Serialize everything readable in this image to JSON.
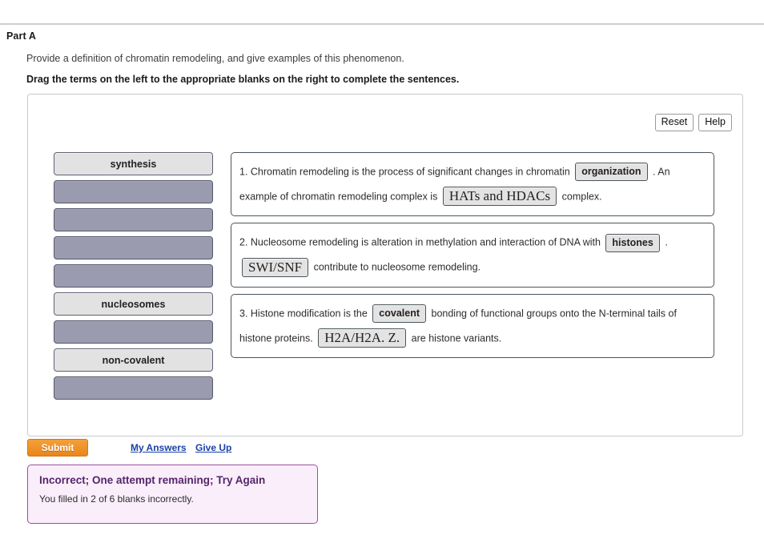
{
  "part": {
    "title": "Part A",
    "prompt": "Provide a definition of chromatin remodeling, and give examples of this phenomenon.",
    "instruction": "Drag the terms on the left to the appropriate blanks on the right to complete the sentences."
  },
  "toolbar": {
    "reset_label": "Reset",
    "help_label": "Help"
  },
  "term_bank": {
    "terms": [
      {
        "label": "synthesis",
        "state": "available"
      },
      {
        "label": "",
        "state": "used"
      },
      {
        "label": "",
        "state": "used"
      },
      {
        "label": "",
        "state": "used"
      },
      {
        "label": "",
        "state": "used"
      },
      {
        "label": "nucleosomes",
        "state": "available"
      },
      {
        "label": "",
        "state": "used"
      },
      {
        "label": "non-covalent",
        "state": "available"
      },
      {
        "label": "",
        "state": "used"
      }
    ]
  },
  "sentences": [
    {
      "part1": "1. Chromatin remodeling is the process of significant changes in chromatin",
      "blank1": "organization",
      "part2": ". An example of chromatin remodeling complex is",
      "blank2": "HATs and HDACs",
      "part3": "complex."
    },
    {
      "part1": "2. Nucleosome remodeling is alteration in methylation and interaction of DNA with",
      "blank1": "histones",
      "part2": ".",
      "blank2": "SWI/SNF",
      "part3": "contribute to nucleosome remodeling."
    },
    {
      "part1": "3. Histone modification is the",
      "blank1": "covalent",
      "part2": "bonding of functional groups onto the N-terminal tails of histone proteins.",
      "blank2": "H2A/H2A. Z.",
      "part3": "are histone variants."
    }
  ],
  "actions": {
    "submit_label": "Submit",
    "my_answers_label": "My Answers",
    "give_up_label": "Give Up"
  },
  "feedback": {
    "title": "Incorrect; One attempt remaining; Try Again",
    "body": "You filled in 2 of 6 blanks incorrectly."
  },
  "colors": {
    "accent_orange": "#ea861b",
    "link_blue": "#1a41a8",
    "used_term": "#9b9baf",
    "feedback_border": "#9c4d9c",
    "feedback_bg": "#fbeefb",
    "feedback_title": "#54256b"
  }
}
